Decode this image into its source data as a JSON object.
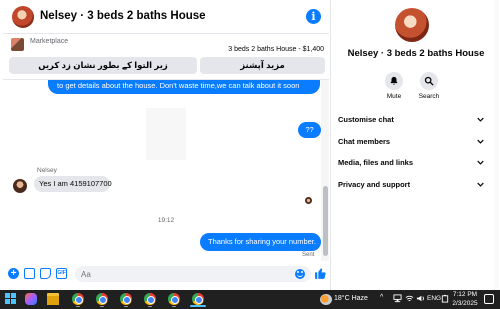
{
  "chat": {
    "title": "Nelsey · 3 beds 2 baths House",
    "marketplace": {
      "label": "Marketplace",
      "listing": "3 beds 2 baths House - $1,400",
      "button_left": "زیر التوا کے بطور نشان زد کریں",
      "button_right": "مزید آپشنز"
    },
    "messages": {
      "outgoing_1": "to get details about the house. Don't waste time,we can talk about it soon",
      "outgoing_2": "??",
      "sender_name": "Nelsey",
      "incoming_1": "Yes I am 4159107700",
      "timestamp": "19:12",
      "outgoing_3": "Thanks for sharing your number.",
      "status": "Sent"
    },
    "composer": {
      "placeholder": "Aa",
      "gif_label": "GIF"
    }
  },
  "details": {
    "name": "Nelsey · 3 beds 2 baths House",
    "actions": {
      "mute": "Mute",
      "search": "Search"
    },
    "sections": [
      {
        "label": "Customise chat"
      },
      {
        "label": "Chat members"
      },
      {
        "label": "Media, files and links"
      },
      {
        "label": "Privacy and support"
      }
    ]
  },
  "taskbar": {
    "weather": "18°C  Haze",
    "language": "ENG",
    "time": "7:12 PM",
    "date": "2/3/2025"
  },
  "colors": {
    "accent": "#0a7cff",
    "bubble_incoming": "#e4e6eb",
    "taskbar": "#202020"
  }
}
